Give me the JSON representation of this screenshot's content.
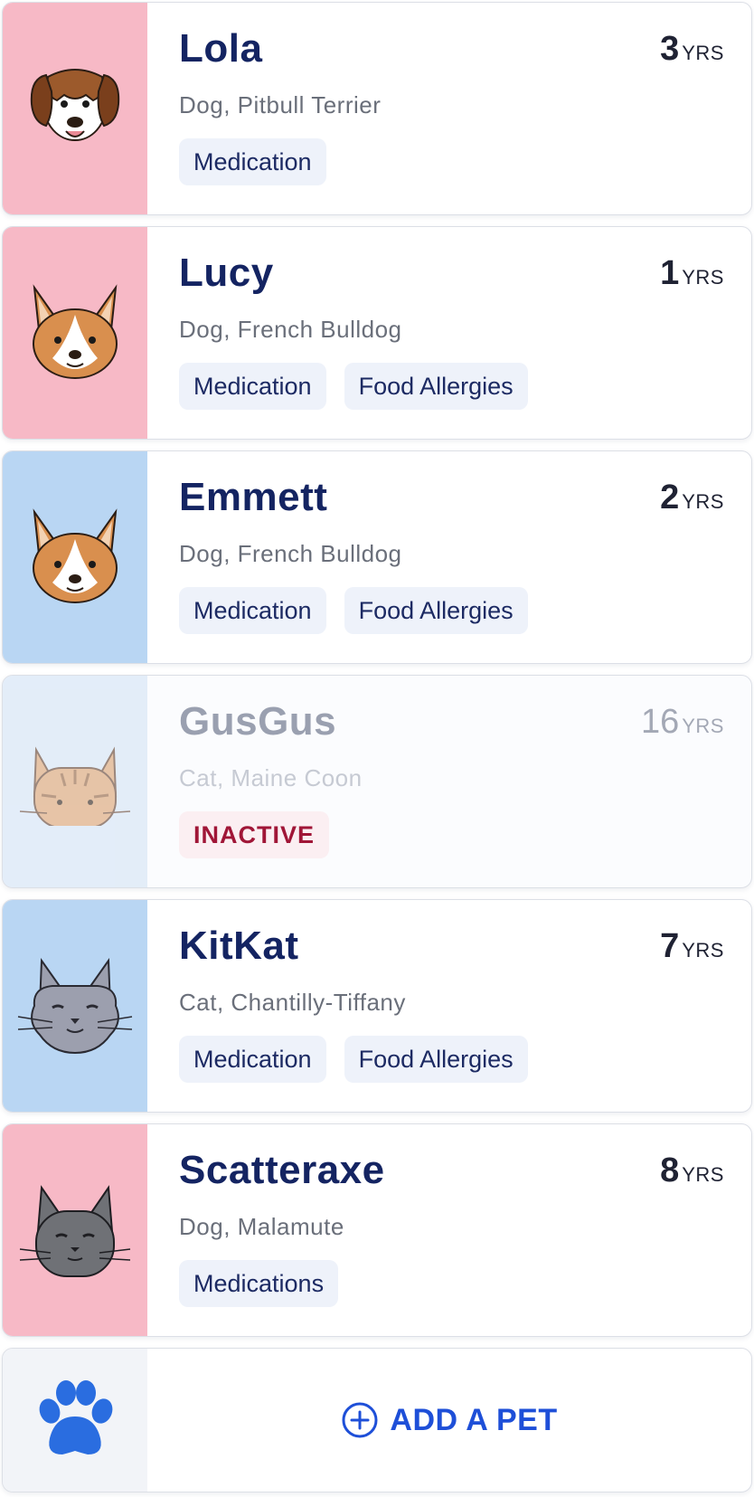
{
  "pets": [
    {
      "name": "Lola",
      "age": "3",
      "age_unit": "YRS",
      "breed": "Dog, Pitbull Terrier",
      "tags": [
        "Medication"
      ],
      "avatar_icon": "beagle-dog-icon",
      "avatar_bg": "#f7b9c6",
      "inactive": false
    },
    {
      "name": "Lucy",
      "age": "1",
      "age_unit": "YRS",
      "breed": "Dog, French Bulldog",
      "tags": [
        "Medication",
        "Food Allergies"
      ],
      "avatar_icon": "corgi-dog-icon",
      "avatar_bg": "#f7b9c6",
      "inactive": false
    },
    {
      "name": "Emmett",
      "age": "2",
      "age_unit": "YRS",
      "breed": "Dog, French Bulldog",
      "tags": [
        "Medication",
        "Food Allergies"
      ],
      "avatar_icon": "corgi-dog-icon",
      "avatar_bg": "#b9d6f3",
      "inactive": false
    },
    {
      "name": "GusGus",
      "age": "16",
      "age_unit": "YRS",
      "breed": "Cat, Maine Coon",
      "tags": [
        "INACTIVE"
      ],
      "avatar_icon": "tabby-cat-icon",
      "avatar_bg": "#dbe8f7",
      "inactive": true
    },
    {
      "name": "KitKat",
      "age": "7",
      "age_unit": "YRS",
      "breed": "Cat, Chantilly-Tiffany",
      "tags": [
        "Medication",
        "Food Allergies"
      ],
      "avatar_icon": "fluffy-gray-cat-icon",
      "avatar_bg": "#b9d6f3",
      "inactive": false
    },
    {
      "name": "Scatteraxe",
      "age": "8",
      "age_unit": "YRS",
      "breed": "Dog, Malamute",
      "tags": [
        "Medications"
      ],
      "avatar_icon": "gray-cat-icon",
      "avatar_bg": "#f7b9c6",
      "inactive": false
    }
  ],
  "add_pet": {
    "label": "ADD A PET",
    "icon": "paw-icon",
    "button_icon": "plus-circle-icon",
    "accent": "#1e4fd8"
  },
  "colors": {
    "name": "#142462",
    "tag_bg": "#eef2fa",
    "tag_text": "#1c2a63",
    "inactive_tag_text": "#a01637"
  }
}
